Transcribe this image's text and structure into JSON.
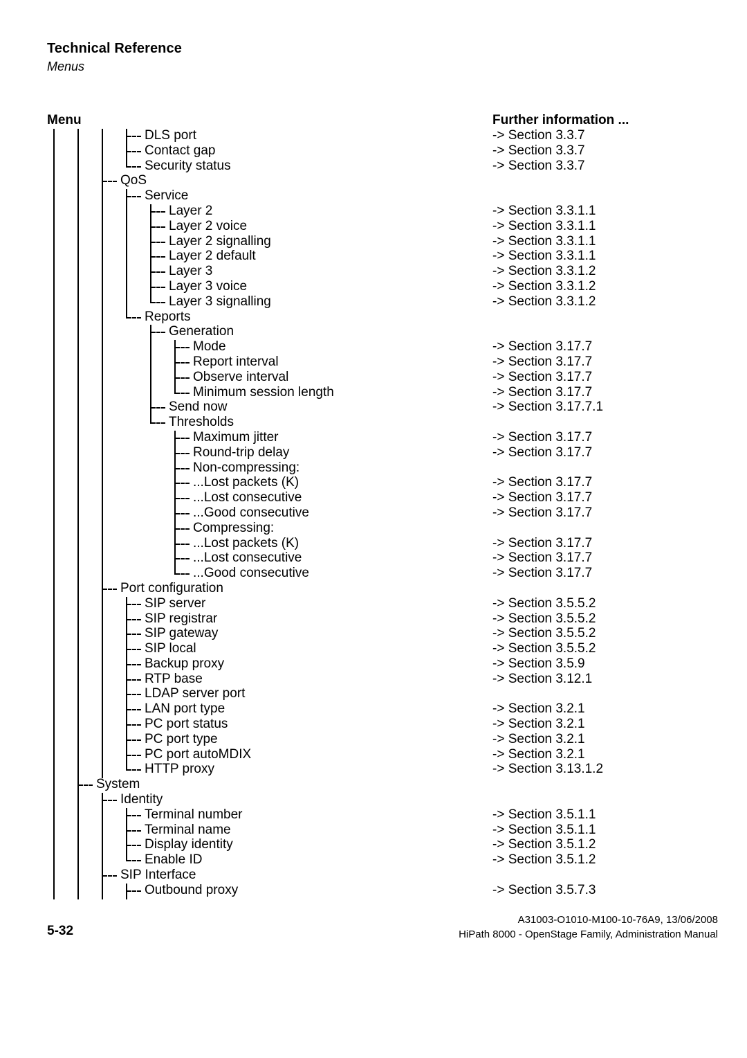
{
  "header": {
    "title": "Technical Reference",
    "subtitle": "Menus"
  },
  "columns": {
    "left_heading": "Menu",
    "right_heading": "Further information ..."
  },
  "tree": {
    "rail_levels": [
      0,
      1,
      2
    ],
    "items": [
      {
        "label": "DLS port",
        "depth": 4,
        "last": false,
        "section": "-> Section 3.3.7"
      },
      {
        "label": "Contact gap",
        "depth": 4,
        "last": false,
        "section": "-> Section 3.3.7"
      },
      {
        "label": "Security status",
        "depth": 4,
        "last": true,
        "section": "-> Section 3.3.7"
      },
      {
        "label": "QoS",
        "depth": 3,
        "last": false,
        "section": ""
      },
      {
        "label": "Service",
        "depth": 4,
        "last": false,
        "section": ""
      },
      {
        "label": "Layer 2",
        "depth": 5,
        "last": false,
        "section": "-> Section 3.3.1.1"
      },
      {
        "label": "Layer 2 voice",
        "depth": 5,
        "last": false,
        "section": "-> Section 3.3.1.1"
      },
      {
        "label": "Layer 2 signalling",
        "depth": 5,
        "last": false,
        "section": "-> Section 3.3.1.1"
      },
      {
        "label": "Layer 2 default",
        "depth": 5,
        "last": false,
        "section": "-> Section 3.3.1.1"
      },
      {
        "label": "Layer 3",
        "depth": 5,
        "last": false,
        "section": "-> Section 3.3.1.2"
      },
      {
        "label": "Layer 3 voice",
        "depth": 5,
        "last": false,
        "section": "-> Section 3.3.1.2"
      },
      {
        "label": "Layer 3 signalling",
        "depth": 5,
        "last": true,
        "section": "-> Section 3.3.1.2"
      },
      {
        "label": "Reports",
        "depth": 4,
        "last": true,
        "section": ""
      },
      {
        "label": "Generation",
        "depth": 5,
        "last": false,
        "section": ""
      },
      {
        "label": "Mode",
        "depth": 6,
        "last": false,
        "section": "-> Section 3.17.7"
      },
      {
        "label": "Report interval",
        "depth": 6,
        "last": false,
        "section": "-> Section 3.17.7"
      },
      {
        "label": "Observe interval",
        "depth": 6,
        "last": false,
        "section": "-> Section 3.17.7"
      },
      {
        "label": "Minimum session length",
        "depth": 6,
        "last": true,
        "section": "-> Section 3.17.7"
      },
      {
        "label": "Send now",
        "depth": 5,
        "last": false,
        "section": "-> Section 3.17.7.1"
      },
      {
        "label": "Thresholds",
        "depth": 5,
        "last": true,
        "section": ""
      },
      {
        "label": "Maximum jitter",
        "depth": 6,
        "last": false,
        "section": "-> Section 3.17.7"
      },
      {
        "label": "Round-trip delay",
        "depth": 6,
        "last": false,
        "section": "-> Section 3.17.7"
      },
      {
        "label": "Non-compressing:",
        "depth": 6,
        "last": false,
        "section": ""
      },
      {
        "label": "...Lost packets (K)",
        "depth": 6,
        "last": false,
        "section": "-> Section 3.17.7"
      },
      {
        "label": "...Lost consecutive",
        "depth": 6,
        "last": false,
        "section": "-> Section 3.17.7"
      },
      {
        "label": "...Good consecutive",
        "depth": 6,
        "last": false,
        "section": "-> Section 3.17.7"
      },
      {
        "label": "Compressing:",
        "depth": 6,
        "last": false,
        "section": ""
      },
      {
        "label": "...Lost packets (K)",
        "depth": 6,
        "last": false,
        "section": "-> Section 3.17.7"
      },
      {
        "label": "...Lost consecutive",
        "depth": 6,
        "last": false,
        "section": "-> Section 3.17.7"
      },
      {
        "label": "...Good consecutive",
        "depth": 6,
        "last": true,
        "section": "-> Section 3.17.7"
      },
      {
        "label": "Port configuration",
        "depth": 3,
        "last": true,
        "section": ""
      },
      {
        "label": "SIP server",
        "depth": 4,
        "last": false,
        "section": "-> Section 3.5.5.2"
      },
      {
        "label": "SIP registrar",
        "depth": 4,
        "last": false,
        "section": "-> Section 3.5.5.2"
      },
      {
        "label": "SIP gateway",
        "depth": 4,
        "last": false,
        "section": "-> Section 3.5.5.2"
      },
      {
        "label": "SIP local",
        "depth": 4,
        "last": false,
        "section": "-> Section 3.5.5.2"
      },
      {
        "label": "Backup proxy",
        "depth": 4,
        "last": false,
        "section": "-> Section 3.5.9"
      },
      {
        "label": "RTP base",
        "depth": 4,
        "last": false,
        "section": "-> Section 3.12.1"
      },
      {
        "label": "LDAP server port",
        "depth": 4,
        "last": false,
        "section": ""
      },
      {
        "label": "LAN port type",
        "depth": 4,
        "last": false,
        "section": "-> Section 3.2.1"
      },
      {
        "label": "PC port status",
        "depth": 4,
        "last": false,
        "section": "-> Section 3.2.1"
      },
      {
        "label": "PC port type",
        "depth": 4,
        "last": false,
        "section": "-> Section 3.2.1"
      },
      {
        "label": "PC port autoMDIX",
        "depth": 4,
        "last": false,
        "section": "-> Section 3.2.1"
      },
      {
        "label": "HTTP proxy",
        "depth": 4,
        "last": true,
        "section": "-> Section 3.13.1.2"
      },
      {
        "label": "System",
        "depth": 2,
        "last": false,
        "section": ""
      },
      {
        "label": "Identity",
        "depth": 3,
        "last": false,
        "section": ""
      },
      {
        "label": "Terminal number",
        "depth": 4,
        "last": false,
        "section": "-> Section 3.5.1.1"
      },
      {
        "label": "Terminal name",
        "depth": 4,
        "last": false,
        "section": "-> Section 3.5.1.1"
      },
      {
        "label": "Display identity",
        "depth": 4,
        "last": false,
        "section": "-> Section 3.5.1.2"
      },
      {
        "label": "Enable ID",
        "depth": 4,
        "last": true,
        "section": "-> Section 3.5.1.2"
      },
      {
        "label": "SIP Interface",
        "depth": 3,
        "last": false,
        "section": ""
      },
      {
        "label": "Outbound proxy",
        "depth": 4,
        "last": false,
        "section": "-> Section 3.5.7.3"
      }
    ]
  },
  "footer": {
    "page_number": "5-32",
    "doc_id": "A31003-O1010-M100-10-76A9, 13/06/2008",
    "doc_title": "HiPath 8000 - OpenStage Family, Administration Manual"
  }
}
